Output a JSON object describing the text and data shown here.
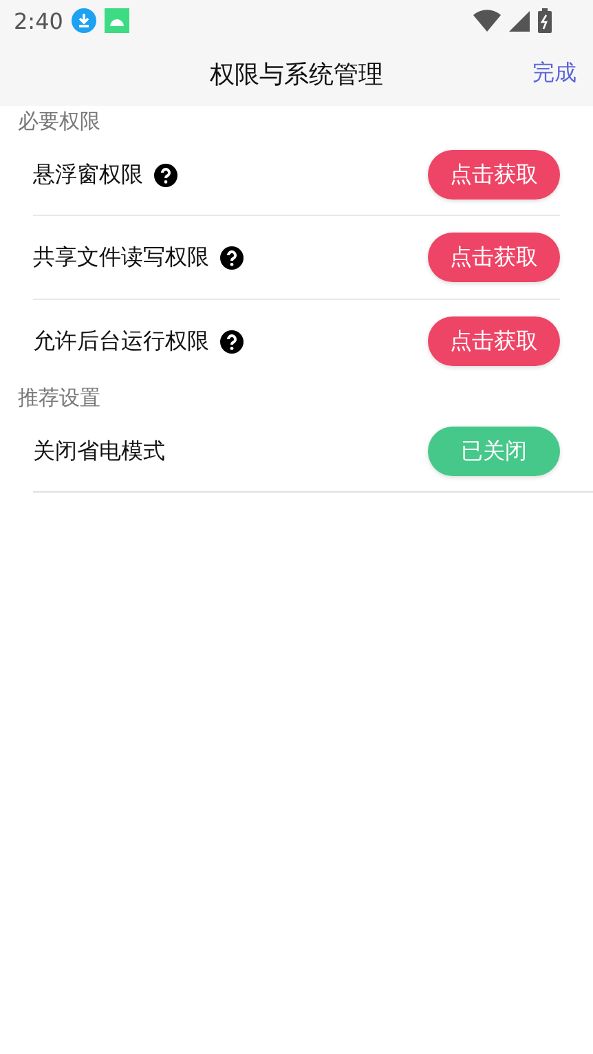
{
  "status_bar": {
    "time": "2:40"
  },
  "header": {
    "title": "权限与系统管理",
    "action": "完成"
  },
  "sections": [
    {
      "title": "必要权限",
      "rows": [
        {
          "label": "悬浮窗权限",
          "help": true,
          "button": "点击获取",
          "granted": false
        },
        {
          "label": "共享文件读写权限",
          "help": true,
          "button": "点击获取",
          "granted": false
        },
        {
          "label": "允许后台运行权限",
          "help": true,
          "button": "点击获取",
          "granted": false
        }
      ]
    },
    {
      "title": "推荐设置",
      "rows": [
        {
          "label": "关闭省电模式",
          "help": false,
          "button": "已关闭",
          "granted": true
        }
      ]
    }
  ]
}
